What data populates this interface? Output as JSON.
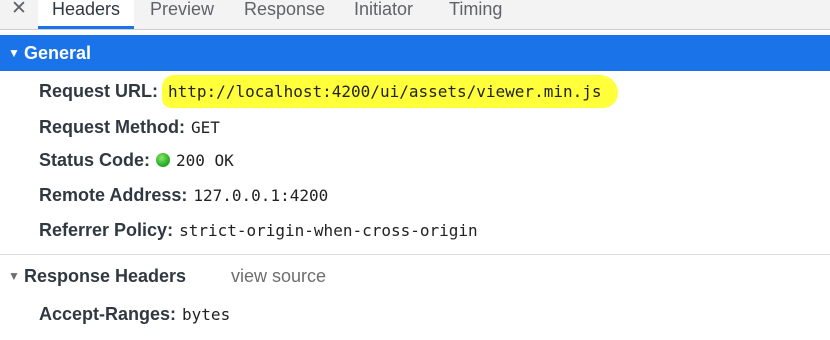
{
  "tabs": {
    "close_symbol": "✕",
    "items": [
      {
        "label": "Headers",
        "active": true
      },
      {
        "label": "Preview"
      },
      {
        "label": "Response"
      },
      {
        "label": "Initiator"
      },
      {
        "label": "Timing"
      }
    ]
  },
  "general": {
    "title": "General",
    "triangle": "▼",
    "request_url": {
      "key": "Request URL:",
      "value": "http://localhost:4200/ui/assets/viewer.min.js"
    },
    "request_method": {
      "key": "Request Method:",
      "value": "GET"
    },
    "status_code": {
      "key": "Status Code:",
      "value": "200 OK",
      "indicator_color": "#2db32d"
    },
    "remote_address": {
      "key": "Remote Address:",
      "value": "127.0.0.1:4200"
    },
    "referrer_policy": {
      "key": "Referrer Policy:",
      "value": "strict-origin-when-cross-origin"
    }
  },
  "response_headers": {
    "title": "Response Headers",
    "triangle": "▼",
    "view_source": "view source",
    "accept_ranges": {
      "key": "Accept-Ranges:",
      "value": "bytes"
    }
  },
  "colors": {
    "accent": "#1a73e8",
    "highlight": "#ffff3a"
  }
}
